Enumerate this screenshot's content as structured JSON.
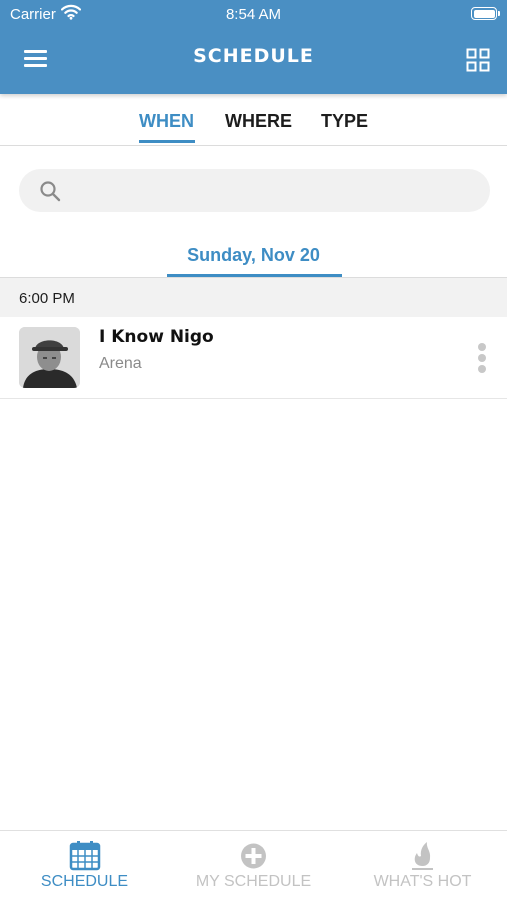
{
  "status_bar": {
    "carrier": "Carrier",
    "time": "8:54 AM"
  },
  "header": {
    "title": "SCHEDULE",
    "menu_icon": "hamburger-icon",
    "grid_icon": "grid-view-icon"
  },
  "tabs": [
    {
      "label": "WHEN",
      "active": true
    },
    {
      "label": "WHERE",
      "active": false
    },
    {
      "label": "TYPE",
      "active": false
    }
  ],
  "search": {
    "placeholder": "",
    "value": ""
  },
  "day": {
    "label": "Sunday, Nov 20"
  },
  "schedule": {
    "time_slot": "6:00 PM",
    "events": [
      {
        "title": "I Know Nigo",
        "venue": "Arena"
      }
    ]
  },
  "bottom_nav": [
    {
      "label": "SCHEDULE",
      "icon": "calendar-icon",
      "active": true
    },
    {
      "label": "MY SCHEDULE",
      "icon": "plus-circle-icon",
      "active": false
    },
    {
      "label": "WHAT'S HOT",
      "icon": "flame-icon",
      "active": false
    }
  ],
  "colors": {
    "brand": "#4a8fc3",
    "accent": "#3e8dc4",
    "inactive": "#c3c3c3"
  }
}
